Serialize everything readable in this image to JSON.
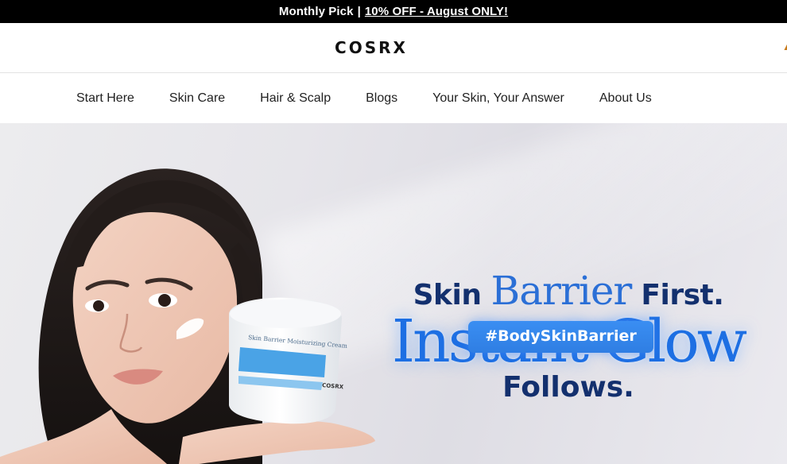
{
  "announcement": {
    "lead": "Monthly Pick",
    "separator": "|",
    "link": "10% OFF - August ONLY!"
  },
  "header": {
    "logo": "COSRX"
  },
  "nav": {
    "items": [
      {
        "label": "Start Here"
      },
      {
        "label": "Skin Care"
      },
      {
        "label": "Hair & Scalp"
      },
      {
        "label": "Blogs"
      },
      {
        "label": "Your Skin, Your Answer"
      },
      {
        "label": "About Us"
      }
    ]
  },
  "hero": {
    "line1_a": "Skin",
    "line1_b": "Barrier",
    "line1_c": "First.",
    "line2": "Instant Glow",
    "line3": "Follows.",
    "hashtag": "#BodySkinBarrier",
    "product_label": "Skin Barrier Moisturizing Cream",
    "product_brand": "COSRX",
    "colors": {
      "navy": "#13306e",
      "accent_blue": "#1d6fe3",
      "button_blue": "#3a8ef2"
    }
  }
}
